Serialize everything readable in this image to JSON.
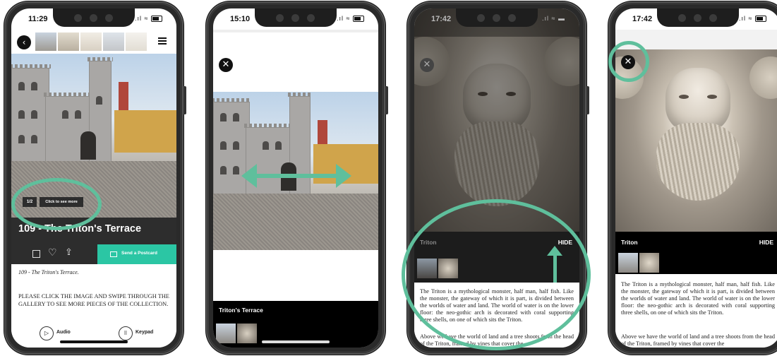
{
  "phone1": {
    "time": "11:29",
    "back_icon": "chevron-left-icon",
    "menu_icon": "list-icon",
    "counter": "1/2",
    "see_more": "Click to see more",
    "title": "109 - The Triton's Terrace",
    "send_postcard": "Send a Postcard",
    "subtitle": "109 - The Triton's Terrace.",
    "instructions": "PLEASE CLICK THE IMAGE AND SWIPE THROUGH THE GALLERY TO SEE MORE PIECES OF THE COLLECTION.",
    "audio_label": "Audio",
    "keypad_label": "Keypad"
  },
  "phone2": {
    "time": "15:10",
    "caption": "Triton's Terrace"
  },
  "phone3": {
    "time": "17:42",
    "caption": "Triton",
    "hide": "HIDE",
    "text1": "The Triton is a mythological monster, half man, half fish. Like the monster, the gateway of which it is part, is divided between the worlds of water and land. The world of water is on the lower floor: the neo-gothic arch is decorated with coral supporting three shells, on one of which sits the Triton.",
    "text2": "Above we have the world of land and a tree shoots from the head of the Triton, framed by vines that cover the"
  },
  "phone4": {
    "time": "17:42",
    "caption": "Triton",
    "hide": "HIDE",
    "text1": "The Triton is a mythological monster, half man, half fish. Like the monster, the gateway of which it is part, is divided between the worlds of water and land. The world of water is on the lower floor: the neo-gothic arch is decorated with coral supporting three shells, on one of which sits the Triton.",
    "text2": "Above we have the world of land and a tree shoots from the head of the Triton, framed by vines that cover the"
  },
  "colors": {
    "accent": "#2bc6a4",
    "ring": "#5fbf9c",
    "dark": "#2d2d2d"
  }
}
